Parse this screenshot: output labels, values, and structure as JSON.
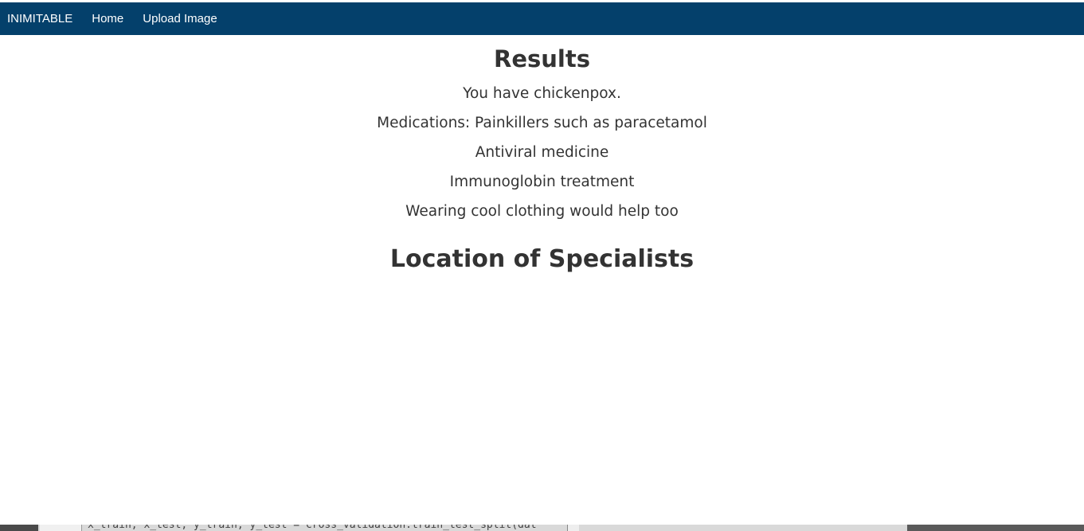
{
  "navbar": {
    "brand": "INIMITABLE",
    "links": [
      {
        "label": "Home"
      },
      {
        "label": "Upload Image"
      }
    ],
    "background": "#04406b"
  },
  "results": {
    "title": "Results",
    "lines": [
      "You have chickenpox.",
      "Medications: Painkillers such as paracetamol",
      "Antiviral medicine",
      "Immunoglobin treatment",
      "Wearing cool clothing would help too"
    ]
  },
  "specialists": {
    "title": "Location of Specialists"
  },
  "background_window": {
    "code_text": "x_train, x_test, y_train, y_test = cross_validation.train_test_split(dat"
  }
}
